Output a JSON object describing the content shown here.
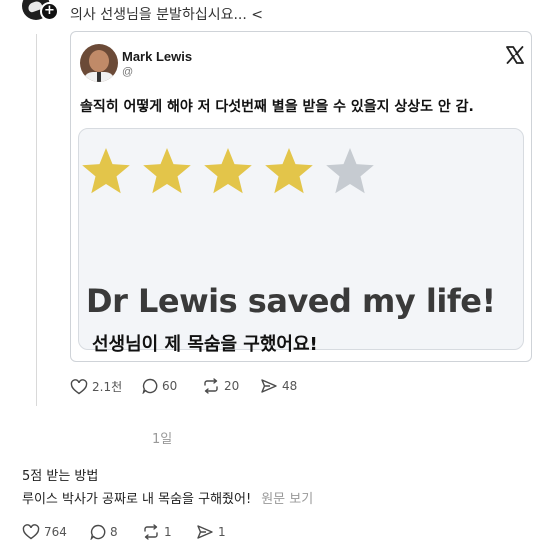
{
  "post": {
    "text": "의사 선생님을 분발하십시요... <",
    "plus_icon_text": "+"
  },
  "embedded_tweet": {
    "author_name": "Mark Lewis",
    "handle": "@",
    "body": "솔직히 어떻게 해야 저 다섯번째 별을 받을 수 있을지 상상도 안 감.",
    "rating": {
      "filled": 4,
      "total": 5
    },
    "quote": "Dr Lewis saved my life!",
    "quote_translation": "선생님이 제 목숨을 구했어요!"
  },
  "post_actions": {
    "likes": "2.1천",
    "replies": "60",
    "reposts": "20",
    "shares": "48"
  },
  "timestamp": "1일",
  "comment": {
    "title": "5점 받는 방법",
    "body": "루이스 박사가 공짜로 내 목숨을 구해줬어!",
    "see_original": "원문 보기",
    "likes": "764",
    "replies": "8",
    "reposts": "1",
    "shares": "1"
  },
  "colors": {
    "star_filled": "#e3c54a",
    "star_empty": "#c6cbd1",
    "icon": "#4a4a4a"
  }
}
